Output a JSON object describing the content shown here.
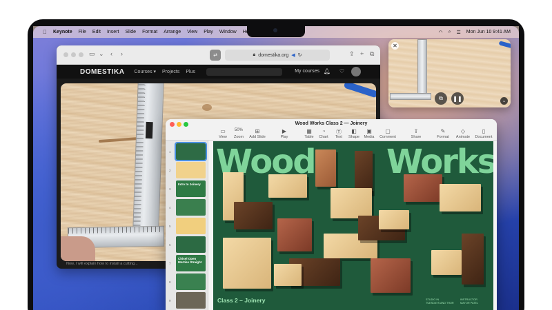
{
  "colors": {
    "slide_background": "#1f5a3b",
    "slide_title": "#7fd49a",
    "accent_blue": "#4a90e2"
  },
  "menubar": {
    "apple_icon": "apple-logo-icon",
    "app_name": "Keynote",
    "items": [
      "File",
      "Edit",
      "Insert",
      "Slide",
      "Format",
      "Arrange",
      "View",
      "Play",
      "Window",
      "Help"
    ],
    "status_icons": [
      "wifi-icon",
      "search-icon",
      "control-center-icon"
    ],
    "clock": "Mon Jun 10  9:41 AM"
  },
  "browser": {
    "url": "domestika.org",
    "site": {
      "logo": "DOMESTIKA",
      "nav": [
        "Courses ▾",
        "Projects",
        "Plus"
      ],
      "my_courses": "My courses"
    },
    "video": {
      "caption": "Now, I will explain how to install a cutting..."
    }
  },
  "pip": {
    "close_glyph": "✕",
    "pip_glyph": "⧉",
    "pause_glyph": "❚❚",
    "expand_glyph": "⌄"
  },
  "keynote": {
    "window_title": "Wood Works Class 2 — Joinery",
    "toolbar": {
      "view": "View",
      "zoom_value": "50%",
      "zoom": "Zoom",
      "add_slide": "Add Slide",
      "play": "Play",
      "table": "Table",
      "chart": "Chart",
      "text": "Text",
      "shape": "Shape",
      "media": "Media",
      "comment": "Comment",
      "share": "Share",
      "format": "Format",
      "animate": "Animate",
      "document": "Document"
    },
    "thumbnails": [
      {
        "num": "1",
        "text": "",
        "color": "#2e6b45"
      },
      {
        "num": "2",
        "text": "",
        "color": "#f1d28c"
      },
      {
        "num": "3",
        "text": "Intro to Joinery",
        "color": "#2f7a45"
      },
      {
        "num": "4",
        "text": "",
        "color": "#3a7f4e"
      },
      {
        "num": "5",
        "text": "",
        "color": "#f1cf7e"
      },
      {
        "num": "6",
        "text": "",
        "color": "#2c6a43"
      },
      {
        "num": "7",
        "text": "Chisel Open Mortise Straight",
        "color": "#2f7a45"
      },
      {
        "num": "8",
        "text": "",
        "color": "#3a8150"
      },
      {
        "num": "9",
        "text": "",
        "color": "#6c6658"
      }
    ],
    "slide": {
      "title_left": "Wood",
      "title_right": "Works",
      "subtitle": "Class 2 – Joinery",
      "meta_left": [
        "STUDIO IN",
        "TUESDAYS AND THUR"
      ],
      "meta_right": [
        "INSTRUCTOR",
        "MAYOR PATEL"
      ]
    }
  }
}
